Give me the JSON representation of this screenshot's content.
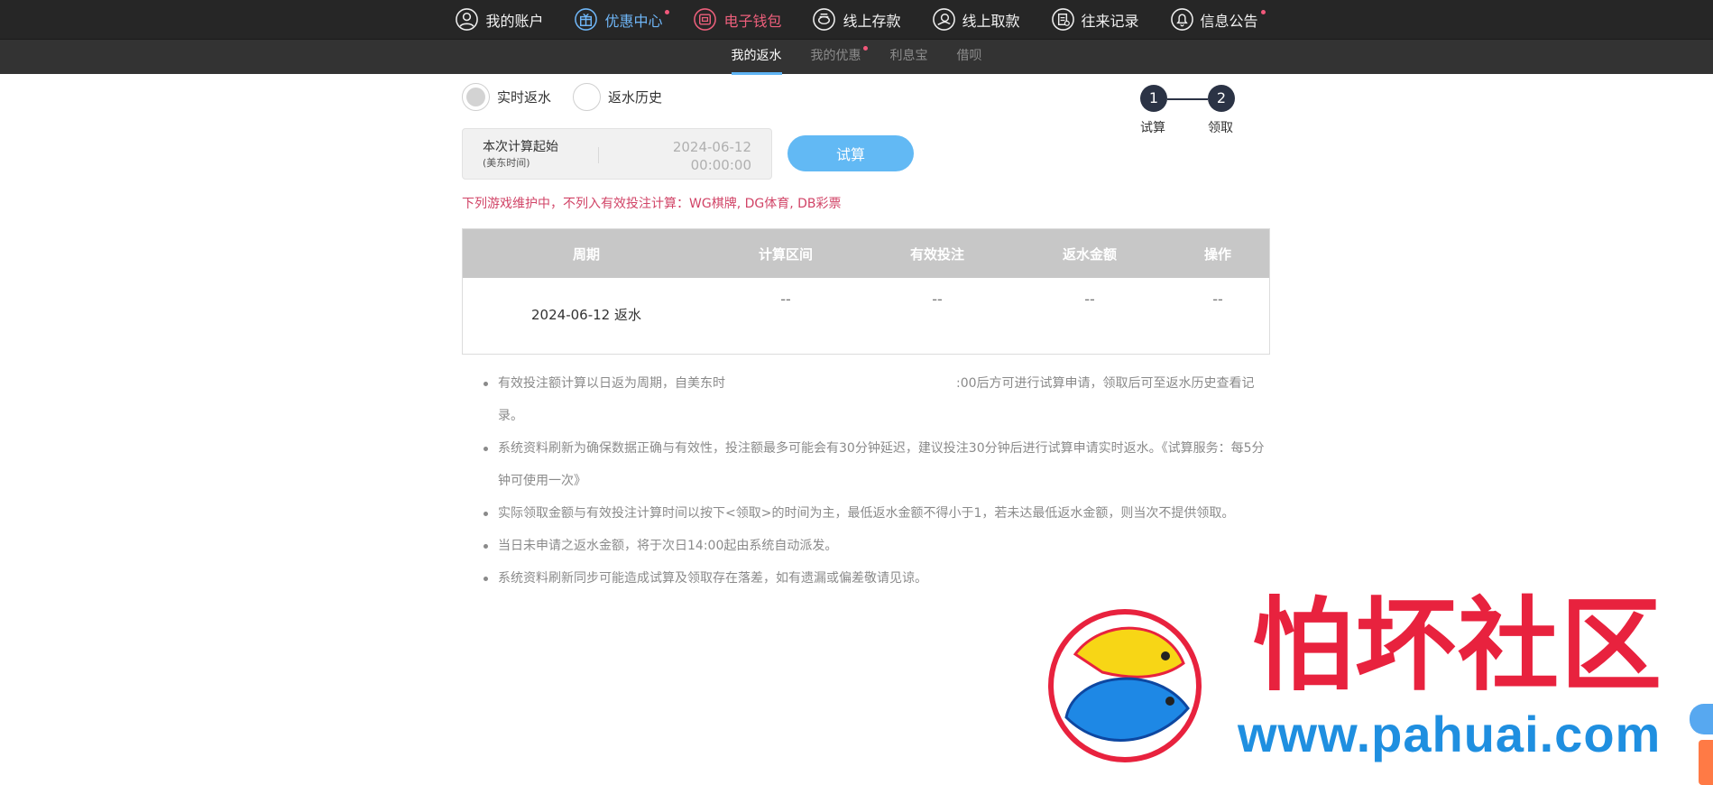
{
  "topnav": {
    "items": [
      {
        "label": "我的账户",
        "icon": "user-circle-icon"
      },
      {
        "label": "优惠中心",
        "icon": "gift-icon",
        "badge": true
      },
      {
        "label": "电子钱包",
        "icon": "wallet-icon"
      },
      {
        "label": "线上存款",
        "icon": "deposit-icon"
      },
      {
        "label": "线上取款",
        "icon": "withdraw-icon"
      },
      {
        "label": "往来记录",
        "icon": "record-icon"
      },
      {
        "label": "信息公告",
        "icon": "bell-icon",
        "badge": true
      }
    ],
    "colors": {
      "bg": "#262626",
      "promo": "#6fb6f7",
      "wallet": "#ec5f7b"
    }
  },
  "subnav": {
    "tabs": [
      {
        "label": "我的返水",
        "active": true
      },
      {
        "label": "我的优惠",
        "badge": true
      },
      {
        "label": "利息宝"
      },
      {
        "label": "借呗"
      }
    ]
  },
  "radios": {
    "realtime": "实时返水",
    "history": "返水历史"
  },
  "steps": {
    "step1_num": "1",
    "step1_label": "试算",
    "step2_num": "2",
    "step2_label": "领取"
  },
  "calc": {
    "label": "本次计算起始",
    "sub_label": "(美东时间)",
    "date": "2024-06-12",
    "time": "00:00:00",
    "button": "试算"
  },
  "notice": "下列游戏维护中，不列入有效投注计算：WG棋牌, DG体育, DB彩票",
  "table": {
    "headers": [
      "周期",
      "计算区间",
      "有效投注",
      "返水金额",
      "操作"
    ],
    "rows": [
      {
        "period": "2024-06-12 返水",
        "range": "--",
        "bet": "--",
        "amount": "--",
        "op": "--"
      }
    ]
  },
  "rules": {
    "r1a": "有效投注额计算以日返为周期，自美东时",
    "r1b": ":00后方可进行试算申请，领取后可至返水历史查看记录。",
    "r2": "系统资料刷新为确保数据正确与有效性，投注额最多可能会有30分钟延迟，建议投注30分钟后进行试算申请实时返水。《试算服务：每5分钟可使用一次》",
    "r3": "实际领取金额与有效投注计算时间以按下<领取>的时间为主，最低返水金额不得小于1，若未达最低返水金额，则当次不提供领取。",
    "r4": "当日未申请之返水金额，将于次日14:00起由系统自动派发。",
    "r5": "系统资料刷新同步可能造成试算及领取存在落差，如有遗漏或偏差敬请见谅。"
  },
  "watermark": {
    "title": "怕坏社区",
    "url": "www.pahuai.com"
  }
}
